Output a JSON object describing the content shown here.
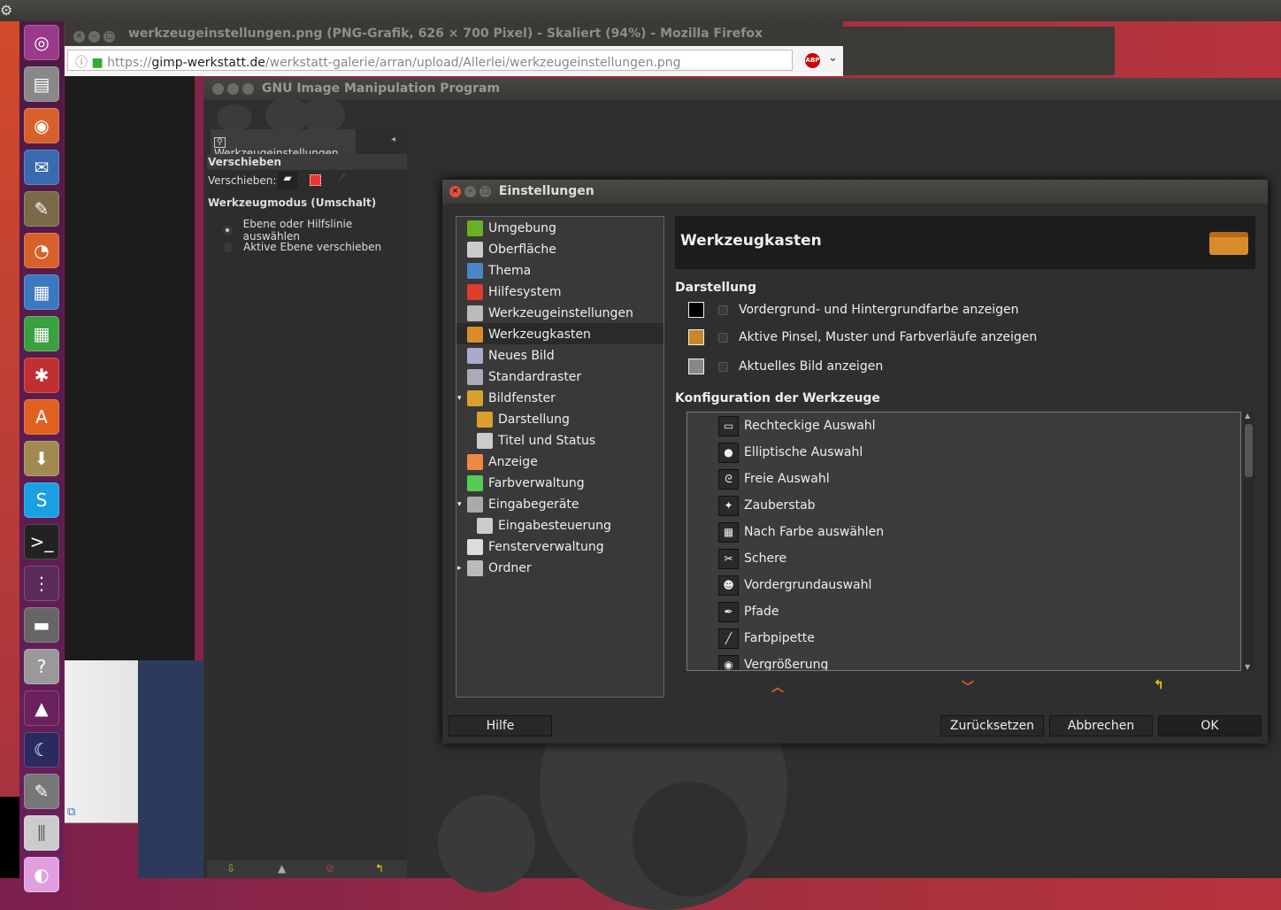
{
  "firefox": {
    "title": "werkzeugeinstellungen.png (PNG-Grafik, 626 × 700 Pixel) - Skaliert (94%) - Mozilla Firefox",
    "url_scheme": "https://",
    "url_domain": "gimp-werkstatt.de",
    "url_path": "/werkstatt-galerie/arran/upload/Allerlei/werkzeugeinstellungen.png",
    "abp_label": "ABP"
  },
  "gimp": {
    "title": "GNU Image Manipulation Program",
    "tool_options": {
      "tab": "Werkzeugeinstellungen",
      "tool": "Verschieben",
      "move_label": "Verschieben:",
      "mode_label": "Werkzeugmodus (Umschalt)",
      "radio": [
        {
          "label": "Ebene oder Hilfslinie auswählen",
          "selected": true
        },
        {
          "label": "Aktive Ebene verschieben",
          "selected": false
        }
      ]
    }
  },
  "dialog": {
    "title": "Einstellungen",
    "nav": [
      {
        "label": "Umgebung",
        "indent": 0,
        "color": "#6ab023"
      },
      {
        "label": "Oberfläche",
        "indent": 0,
        "color": "#cccccc"
      },
      {
        "label": "Thema",
        "indent": 0,
        "color": "#4a86c8"
      },
      {
        "label": "Hilfesystem",
        "indent": 0,
        "color": "#e03b2c"
      },
      {
        "label": "Werkzeugeinstellungen",
        "indent": 0,
        "color": "#bbbbbb"
      },
      {
        "label": "Werkzeugkasten",
        "indent": 0,
        "color": "#d98c2a",
        "selected": true
      },
      {
        "label": "Neues Bild",
        "indent": 0,
        "color": "#aac"
      },
      {
        "label": "Standardraster",
        "indent": 0,
        "color": "#aab"
      },
      {
        "label": "Bildfenster",
        "indent": 0,
        "color": "#d9a030",
        "expander": "▾"
      },
      {
        "label": "Darstellung",
        "indent": 1,
        "color": "#d9a030"
      },
      {
        "label": "Titel und Status",
        "indent": 1,
        "color": "#ccc"
      },
      {
        "label": "Anzeige",
        "indent": 0,
        "color": "#e84"
      },
      {
        "label": "Farbverwaltung",
        "indent": 0,
        "color": "#5c5"
      },
      {
        "label": "Eingabegeräte",
        "indent": 0,
        "color": "#aaa",
        "expander": "▾"
      },
      {
        "label": "Eingabesteuerung",
        "indent": 1,
        "color": "#ccc"
      },
      {
        "label": "Fensterverwaltung",
        "indent": 0,
        "color": "#ddd"
      },
      {
        "label": "Ordner",
        "indent": 0,
        "color": "#bbb",
        "expander": "▸"
      }
    ],
    "header": "Werkzeugkasten",
    "section_appearance": "Darstellung",
    "options": [
      {
        "label": "Vordergrund- und Hintergrundfarbe anzeigen",
        "checked": false,
        "icon": "fg-bg-color-icon"
      },
      {
        "label": "Aktive Pinsel, Muster und Farbverläufe anzeigen",
        "checked": false,
        "icon": "brush-icon"
      },
      {
        "label": "Aktuelles Bild anzeigen",
        "checked": false,
        "icon": "image-icon"
      }
    ],
    "section_tools": "Konfiguration der Werkzeuge",
    "tools": [
      {
        "label": "Rechteckige Auswahl",
        "glyph": "▭"
      },
      {
        "label": "Elliptische Auswahl",
        "glyph": "●"
      },
      {
        "label": "Freie Auswahl",
        "glyph": "ᘓ"
      },
      {
        "label": "Zauberstab",
        "glyph": "✦"
      },
      {
        "label": "Nach Farbe auswählen",
        "glyph": "▦"
      },
      {
        "label": "Schere",
        "glyph": "✂"
      },
      {
        "label": "Vordergrundauswahl",
        "glyph": "☻"
      },
      {
        "label": "Pfade",
        "glyph": "✒"
      },
      {
        "label": "Farbpipette",
        "glyph": "╱"
      },
      {
        "label": "Vergrößerung",
        "glyph": "◉"
      }
    ],
    "buttons": {
      "help": "Hilfe",
      "reset": "Zurücksetzen",
      "cancel": "Abbrechen",
      "ok": "OK"
    },
    "accent": "#e9662c"
  }
}
